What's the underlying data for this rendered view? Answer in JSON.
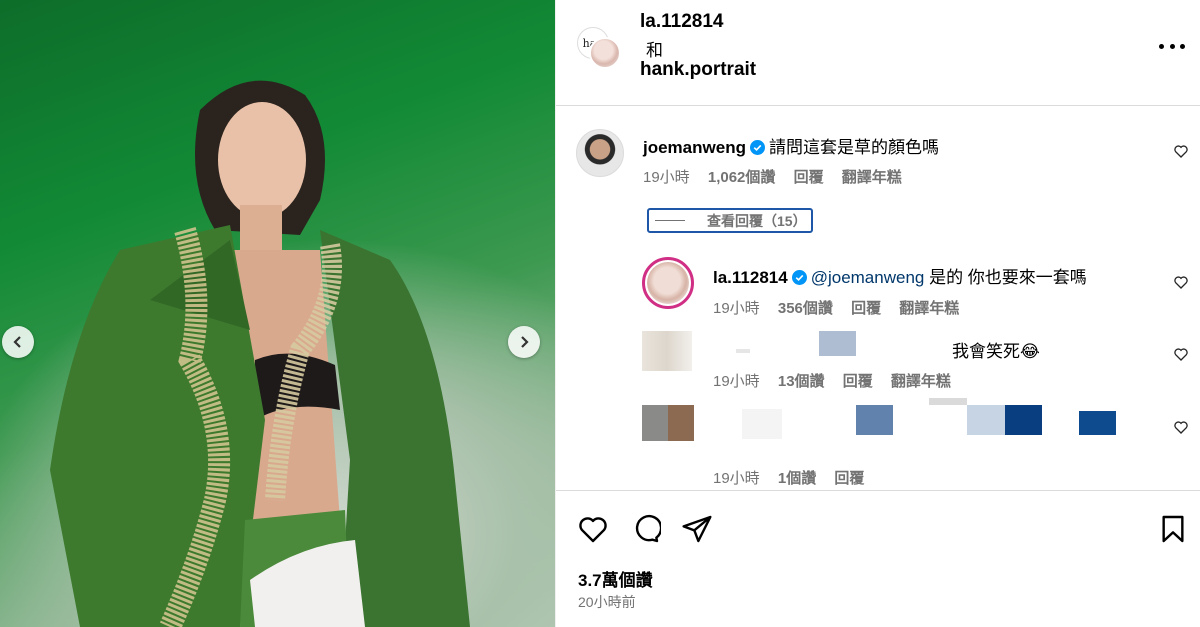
{
  "header": {
    "user1": "la.112814",
    "conjunction": "和",
    "user2": "hank.portrait",
    "collab_avatar1_text": "han"
  },
  "comments": [
    {
      "username": "joemanweng",
      "verified": true,
      "text": "請問這套是草的顏色嗎",
      "time": "19小時",
      "likes": "1,062個讚",
      "reply": "回覆",
      "translate": "翻譯年糕",
      "view_replies": "查看回覆（15）"
    },
    {
      "username": "la.112814",
      "verified": true,
      "mention": "@joemanweng",
      "text": " 是的 你也要來一套嗎",
      "time": "19小時",
      "likes": "356個讚",
      "reply": "回覆",
      "translate": "翻譯年糕"
    },
    {
      "text": "我會笑死😂",
      "time": "19小時",
      "likes": "13個讚",
      "reply": "回覆",
      "translate": "翻譯年糕"
    },
    {
      "time": "19小時",
      "likes": "1個讚",
      "reply": "回覆"
    }
  ],
  "footer": {
    "likes": "3.7萬個讚",
    "time": "20小時前"
  },
  "colors": {
    "verified": "#0095f6",
    "link": "#00376b",
    "highlight_box": "#1f57a8",
    "photo_green": "#128a35"
  },
  "icons": [
    "chevron-left-icon",
    "chevron-right-icon",
    "more-icon",
    "verified-icon",
    "heart-icon",
    "comment-icon",
    "share-icon",
    "bookmark-icon"
  ]
}
